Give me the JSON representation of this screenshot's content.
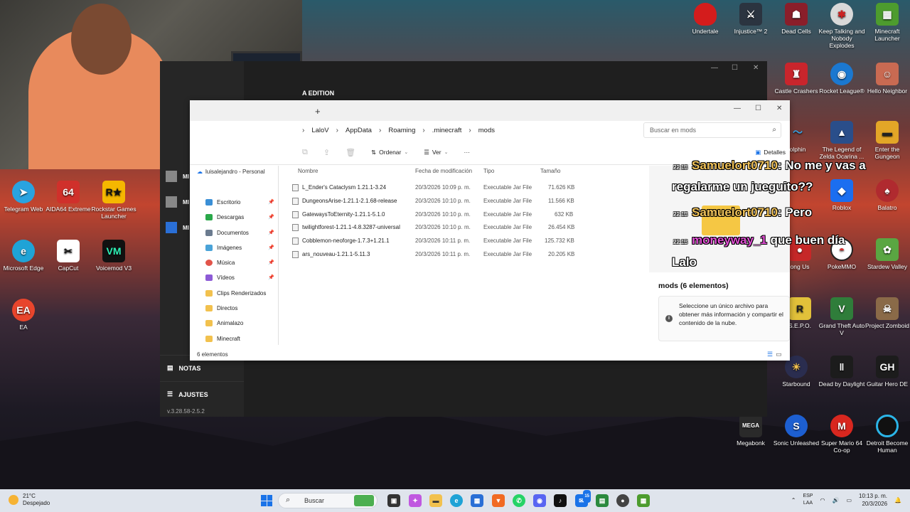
{
  "desktop_icons": {
    "undertale": "Undertale",
    "injustice": "Injustice™ 2",
    "dead_cells": "Dead Cells",
    "keep_talking": "Keep Talking and Nobody Explodes",
    "minecraft_launcher": "Minecraft Launcher",
    "castle_crashers": "Castle Crashers",
    "rocket_league": "Rocket League®",
    "hello_neighbor": "Hello Neighbor",
    "dolphin": "olphin",
    "zelda": "The Legend of Zelda Ocarina ...",
    "enter_gungeon": "Enter the Gungeon",
    "telegram": "Telegram Web",
    "aida64": "AIDA64 Extreme",
    "rockstar": "Rockstar Games Launcher",
    "roblox": "Roblox",
    "balatro": "Balatro",
    "edge": "Microsoft Edge",
    "capcut": "CapCut",
    "voicemod": "Voicemod V3",
    "among_us": "ong Us",
    "pokemmo": "PokeMMO",
    "stardew": "Stardew Valley",
    "ea": "EA",
    "sep": "S.E.P.O.",
    "gta": "Grand Theft Auto V",
    "project_zomboid": "Project Zomboid",
    "starbound": "Starbound",
    "dead_by_daylight": "Dead by Daylight",
    "guitar_hero": "Guitar Hero DE",
    "megabonk": "Megabonk",
    "sonic": "Sonic Unleashed",
    "mario64": "Super Mario 64 Co-op",
    "detroit": "Detroit Become Human"
  },
  "launcher": {
    "title_fragment": "A EDITION",
    "side_items": [
      "MI BE",
      "MI DU",
      "MI LE"
    ],
    "notas": "NOTAS",
    "ajustes": "AJUSTES",
    "version": "v.3.28.58-2.5.2"
  },
  "explorer": {
    "new_tab": "+",
    "breadcrumb": [
      "LaloV",
      "AppData",
      "Roaming",
      ".minecraft",
      "mods"
    ],
    "search_placeholder": "Buscar en mods",
    "toolbar": {
      "ordenar": "Ordenar",
      "ver": "Ver",
      "more": "···",
      "detalles": "Detalles"
    },
    "nav_top": "luisalejandro - Personal",
    "nav_items": [
      {
        "label": "Escritorio",
        "color": "#3a8fd6"
      },
      {
        "label": "Descargas",
        "color": "#2aa84a"
      },
      {
        "label": "Documentos",
        "color": "#6b7b8f"
      },
      {
        "label": "Imágenes",
        "color": "#4aa3d8"
      },
      {
        "label": "Música",
        "color": "#e2544a"
      },
      {
        "label": "Vídeos",
        "color": "#8d5bd6"
      },
      {
        "label": "Clips Renderizados",
        "color": "#f2c14e"
      },
      {
        "label": "Directos",
        "color": "#f2c14e"
      },
      {
        "label": "Animalazo",
        "color": "#f2c14e"
      },
      {
        "label": "Minecraft",
        "color": "#f2c14e"
      }
    ],
    "columns": {
      "name": "Nombre",
      "date": "Fecha de modificación",
      "type": "Tipo",
      "size": "Tamaño"
    },
    "files": [
      {
        "name": "L_Ender's Cataclysm 1.21.1-3.24",
        "date": "20/3/2026 10:09 p. m.",
        "type": "Executable Jar File",
        "size": "71.626 KB"
      },
      {
        "name": "DungeonsArise-1.21.1-2.1.68-release",
        "date": "20/3/2026 10:10 p. m.",
        "type": "Executable Jar File",
        "size": "11.566 KB"
      },
      {
        "name": "GatewaysToEternity-1.21.1-5.1.0",
        "date": "20/3/2026 10:10 p. m.",
        "type": "Executable Jar File",
        "size": "632 KB"
      },
      {
        "name": "twilightforest-1.21.1-4.8.3287-universal",
        "date": "20/3/2026 10:10 p. m.",
        "type": "Executable Jar File",
        "size": "26.454 KB"
      },
      {
        "name": "Cobblemon-neoforge-1.7.3+1.21.1",
        "date": "20/3/2026 10:11 p. m.",
        "type": "Executable Jar File",
        "size": "125.732 KB"
      },
      {
        "name": "ars_nouveau-1.21.1-5.11.3",
        "date": "20/3/2026 10:11 p. m.",
        "type": "Executable Jar File",
        "size": "20.205 KB"
      }
    ],
    "chat": [
      {
        "time": "22:13",
        "user": "Samuelort0710",
        "msg": ": No me y vas a"
      },
      {
        "time": "",
        "user": "",
        "msg": "regalarme un jueguito??"
      },
      {
        "time": "22:13",
        "user": "Samuelort0710",
        "msg": ": Pero"
      },
      {
        "time": "22:13",
        "user": "moneyway_1",
        "msg": "que buen día"
      },
      {
        "time": "",
        "user": "",
        "msg": "Lalo"
      }
    ],
    "details_title": "mods (6 elementos)",
    "details_info": "Seleccione un único archivo para obtener más información y compartir el contenido de la nube.",
    "status": "6 elementos"
  },
  "taskbar": {
    "temp": "21°C",
    "weather": "Despejado",
    "search": "Buscar",
    "lang1": "ESP",
    "lang2": "LAA",
    "time": "10:13 p. m.",
    "date": "20/3/2026",
    "badge": "15"
  }
}
